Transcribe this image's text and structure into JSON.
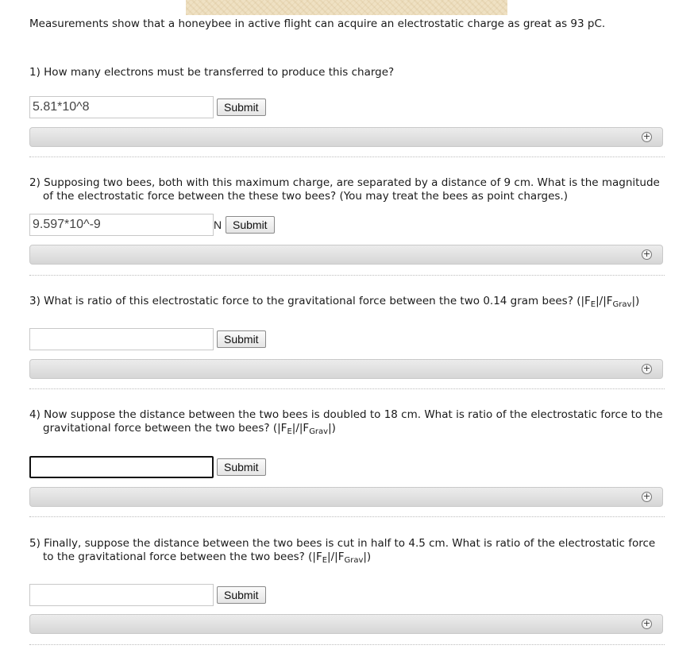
{
  "intro": "Measurements show that a honeybee in active flight can acquire an electrostatic charge as great as 93 pC.",
  "submit_label": "Submit",
  "expand_glyph": "+",
  "questions": [
    {
      "number": "1)",
      "text": "How many electrons must be transferred to produce this charge?",
      "answer_value": "5.81*10^8",
      "unit": ""
    },
    {
      "number": "2)",
      "text": "Supposing two bees, both with this maximum charge, are separated by a distance of 9 cm. What is the magnitude of the electrostatic force between the these two bees? (You may treat the bees as point charges.)",
      "answer_value": "9.597*10^-9",
      "unit": "N"
    },
    {
      "number": "3)",
      "text": "What is ratio of this electrostatic force to the gravitational force between the two 0.14 gram bees?",
      "ratio_open": "(|F",
      "ratio_sub1": "E",
      "ratio_mid": "|/|F",
      "ratio_sub2": "Grav",
      "ratio_close": "|)",
      "answer_value": "",
      "unit": ""
    },
    {
      "number": "4)",
      "text": "Now suppose the distance between the two bees is doubled to 18 cm. What is ratio of the electrostatic force to the gravitational force between the two bees?",
      "ratio_open": "(|F",
      "ratio_sub1": "E",
      "ratio_mid": "|/|F",
      "ratio_sub2": "Grav",
      "ratio_close": "|)",
      "answer_value": "",
      "unit": ""
    },
    {
      "number": "5)",
      "text": "Finally, suppose the distance between the two bees is cut in half to 4.5 cm. What is ratio of the electrostatic force to the gravitational force between the two bees?",
      "ratio_open": "(|F",
      "ratio_sub1": "E",
      "ratio_mid": "|/|F",
      "ratio_sub2": "Grav",
      "ratio_close": "|)",
      "answer_value": "",
      "unit": ""
    }
  ]
}
